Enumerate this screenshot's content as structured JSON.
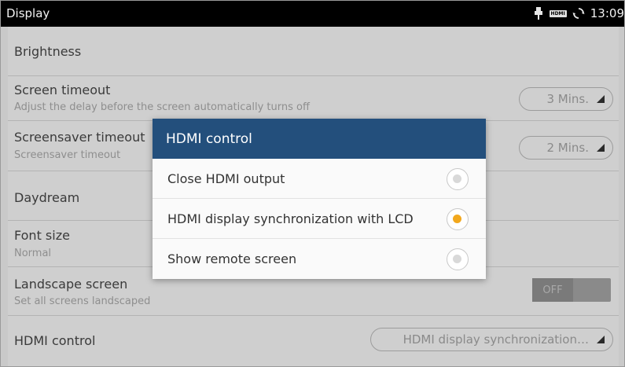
{
  "statusbar": {
    "title": "Display",
    "time": "13:09",
    "icons": [
      "usb-debug-icon",
      "hdmi-icon",
      "sync-icon"
    ],
    "hdmi_badge": "HDMI"
  },
  "settings": {
    "brightness": {
      "label": "Brightness"
    },
    "screen_timeout": {
      "label": "Screen timeout",
      "summary": "Adjust the delay before the screen automatically turns off",
      "value": "3 Mins."
    },
    "screensaver_timeout": {
      "label": "Screensaver timeout",
      "summary": "Screensaver timeout",
      "value": "2 Mins."
    },
    "daydream": {
      "label": "Daydream"
    },
    "font_size": {
      "label": "Font size",
      "summary": "Normal"
    },
    "landscape_screen": {
      "label": "Landscape screen",
      "summary": "Set all screens landscaped",
      "toggle": "OFF"
    },
    "hdmi_control": {
      "label": "HDMI control",
      "value": "HDMI display synchronization…"
    }
  },
  "dialog": {
    "title": "HDMI control",
    "options": [
      {
        "label": "Close HDMI output",
        "selected": false
      },
      {
        "label": "HDMI display synchronization with LCD",
        "selected": true
      },
      {
        "label": "Show remote screen",
        "selected": false
      }
    ]
  },
  "colors": {
    "dialog_header": "#234f7c",
    "radio_selected": "#f2a81d",
    "statusbar": "#000000"
  }
}
